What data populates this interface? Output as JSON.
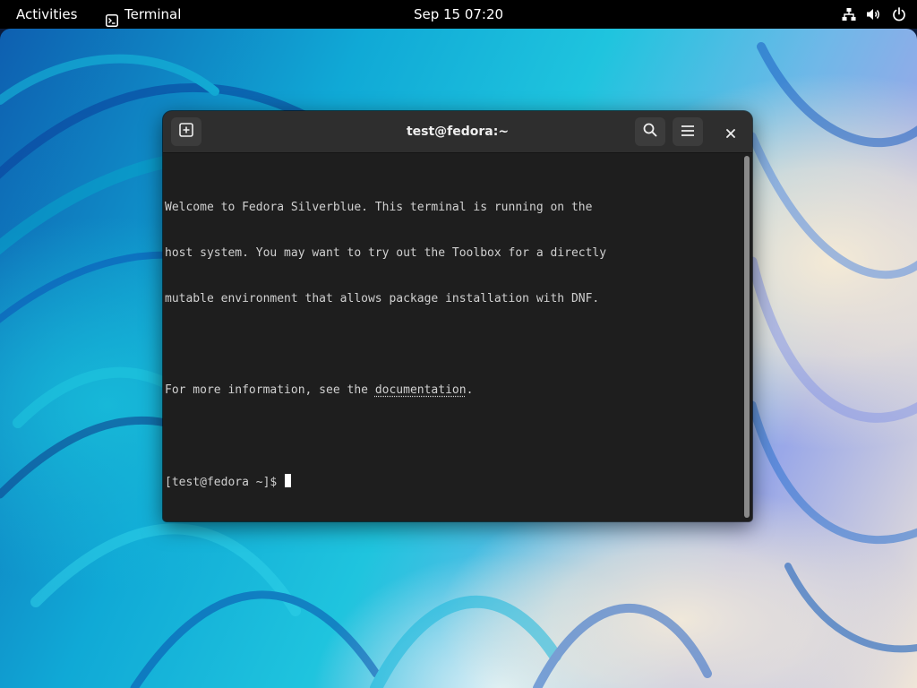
{
  "topbar": {
    "activities": "Activities",
    "app_name": "Terminal",
    "clock": "Sep 15  07:20",
    "icons": [
      "network-wired-icon",
      "volume-icon",
      "power-icon"
    ]
  },
  "window": {
    "title": "test@fedora:~",
    "buttons": {
      "new_tab": "new-tab-icon",
      "search": "search-icon",
      "menu": "hamburger-menu-icon",
      "close": "close-icon"
    }
  },
  "terminal": {
    "lines": [
      "Welcome to Fedora Silverblue. This terminal is running on the",
      "host system. You may want to try out the Toolbox for a directly",
      "mutable environment that allows package installation with DNF.",
      ""
    ],
    "info_prefix": "For more information, see the ",
    "info_link": "documentation",
    "info_suffix": ".",
    "prompt": "[test@fedora ~]$ "
  },
  "colors": {
    "topbar_bg": "#000000",
    "headerbar_bg": "#2e2e2e",
    "terminal_bg": "#1e1e1e",
    "terminal_fg": "#d0d0d0"
  }
}
